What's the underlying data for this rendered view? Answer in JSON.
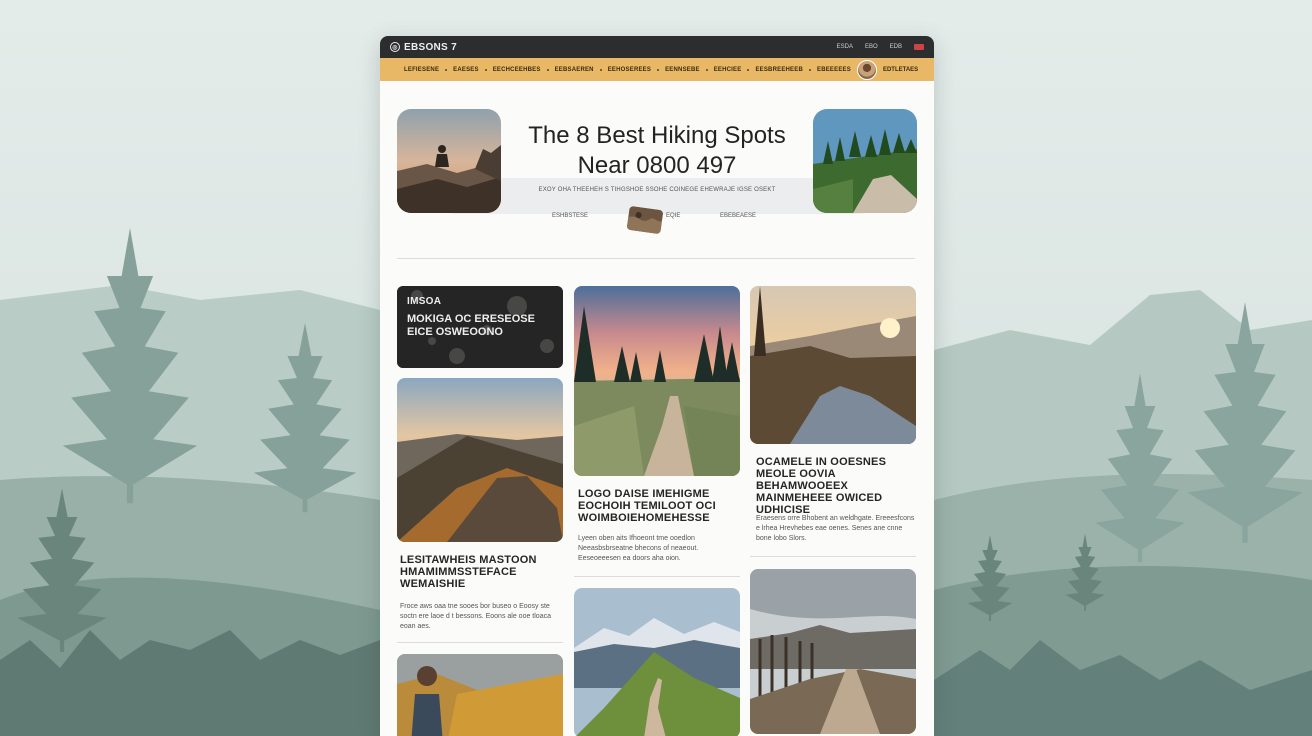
{
  "topbar": {
    "brand": "EBSONS 7",
    "links": [
      "ESDA",
      "EBO",
      "EDB"
    ]
  },
  "nav": {
    "items": [
      "LEFIESENE",
      "EAESES",
      "EECHCEEHBES",
      "EEBSAEREN",
      "EEHOSEREES",
      "EENNSEBE",
      "EEHCIEE",
      "EESBREEHEEB",
      "EBEEEEES"
    ],
    "account_label": "EDTLETAES"
  },
  "hero": {
    "title_line1": "The 8 Best Hiking Spots",
    "title_line2": "Near 0800 497",
    "subline": "EXOY OHA THEEHEH S TIHGSHOE SSOHE COINEGE EHEWRAJE IGSE OSEKT",
    "meta_left": "ESHBSTESE",
    "meta_mid": "EQIE",
    "meta_right": "EBEBEAESE"
  },
  "cards": {
    "feature": {
      "label": "IMSOA",
      "title": "MOKIGA OC ERESEOSE EICE OSWEOONO"
    },
    "col1_title": "LESITAWHEIS MASTOON HMAMIMMSSTEFACE WEMAISHIE",
    "col1_desc": "Froce aws oaa tne sooes bor buseo o Eoosy ste soctn ere laoe d t bessons. Eoons ale ooe tloaca eoan aes.",
    "col2_title": "LOGO DAISE IMEHIGME EOCHOIH TEMILOOT OCI WOIMBOIEHOMEHESSE",
    "col2_desc": "Lyeen oben aits Ifhoeont tme ooedlon Neeasbsbrseatne bhecons of neaeout. Eeseoeeesen ea doors aha oion.",
    "col3_title": "OCAMELE IN OOESNES MEOLE OOVIA BEHAMWOOEEX MAINMEHEEE OWICED UDHICISE",
    "col3_desc": "Eraesens orre Bhobent an weldhgate. Ereeesfcons e lrhea Hrevhebes eae oenes. Senes ane cnne bone lobo Slors."
  }
}
